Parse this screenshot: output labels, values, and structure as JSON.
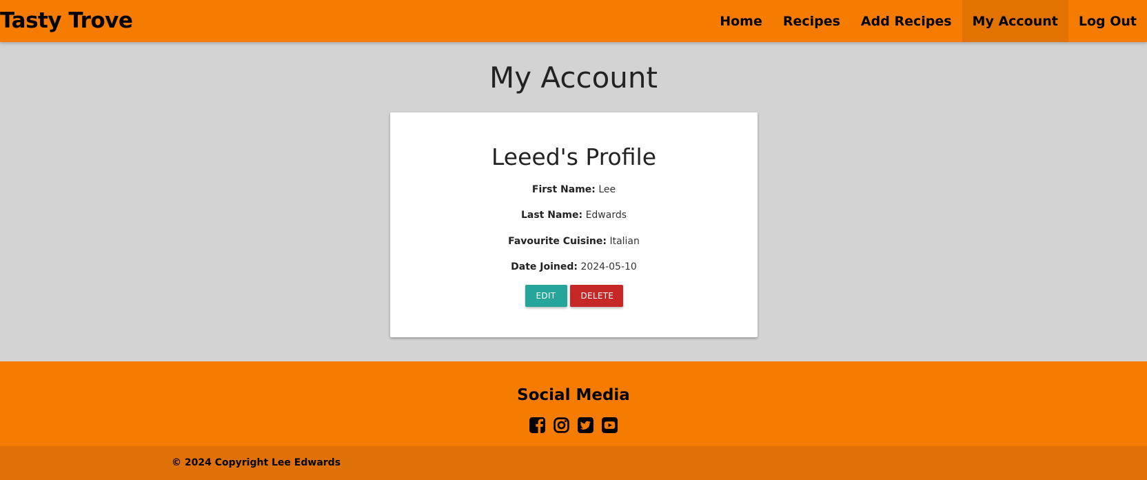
{
  "header": {
    "brand": "Tasty Trove",
    "nav": [
      {
        "label": "Home"
      },
      {
        "label": "Recipes"
      },
      {
        "label": "Add Recipes"
      },
      {
        "label": "My Account",
        "active": true
      },
      {
        "label": "Log Out"
      }
    ]
  },
  "main": {
    "page_title": "My Account",
    "profile": {
      "title": "Leeed's Profile",
      "fields": [
        {
          "label": "First Name:",
          "value": "Lee"
        },
        {
          "label": "Last Name:",
          "value": "Edwards"
        },
        {
          "label": "Favourite Cuisine:",
          "value": "Italian"
        },
        {
          "label": "Date Joined:",
          "value": "2024-05-10"
        }
      ],
      "edit_label": "EDIT",
      "delete_label": "DELETE"
    }
  },
  "footer": {
    "social_title": "Social Media",
    "icons": [
      "facebook-icon",
      "instagram-icon",
      "twitter-icon",
      "youtube-icon"
    ],
    "copyright": "© 2024 Copyright Lee Edwards"
  },
  "colors": {
    "nav_bg": "#f57c00",
    "copyright_bg": "#e07106",
    "page_bg": "#d3d3d3",
    "edit_button": "#26a69a",
    "delete_button": "#c62828"
  }
}
